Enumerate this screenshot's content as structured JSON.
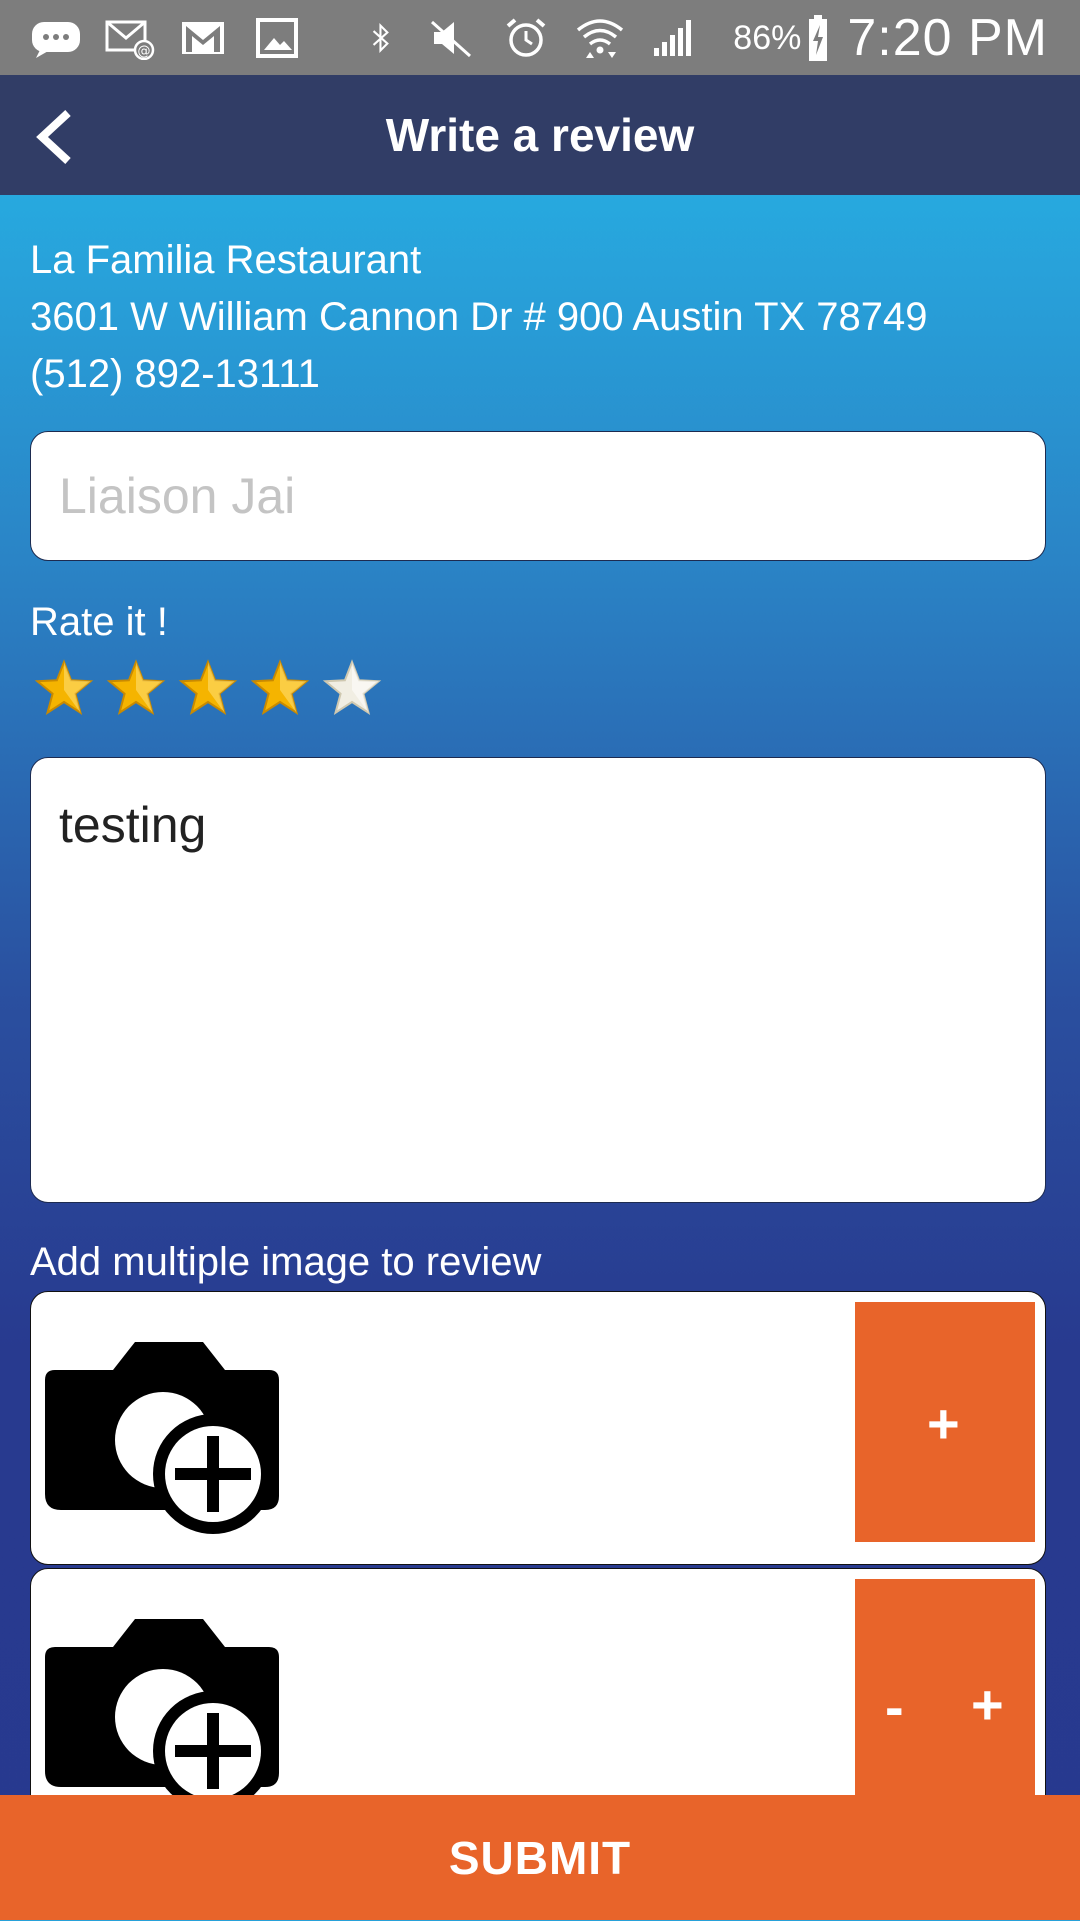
{
  "status_bar": {
    "battery": "86%",
    "time": "7:20 PM",
    "icons": [
      "chat-bubble-icon",
      "email-at-icon",
      "gmail-icon",
      "gallery-icon",
      "bluetooth-icon",
      "mute-icon",
      "alarm-icon",
      "wifi-icon",
      "signal-icon",
      "battery-charging-icon"
    ]
  },
  "header": {
    "title": "Write a review",
    "back_icon": "chevron-left-icon"
  },
  "restaurant": {
    "name": "La Familia Restaurant",
    "address": "3601 W William Cannon Dr # 900 Austin TX 78749",
    "phone": "(512) 892-13111"
  },
  "form": {
    "name_placeholder": "Liaison Jai",
    "name_value": "",
    "rate_label": "Rate it !",
    "rating": 4,
    "max_rating": 5,
    "review_text": "testing",
    "add_images_label": "Add multiple image to review"
  },
  "image_rows": [
    {
      "icon": "camera-add-icon",
      "buttons": [
        "+"
      ]
    },
    {
      "icon": "camera-add-icon",
      "buttons": [
        "-",
        "+"
      ]
    }
  ],
  "submit_label": "SUBMIT",
  "colors": {
    "accent": "#e8642a",
    "app_bar": "#313d66",
    "star_filled": "#f5b400",
    "star_empty": "#f1eee3"
  }
}
